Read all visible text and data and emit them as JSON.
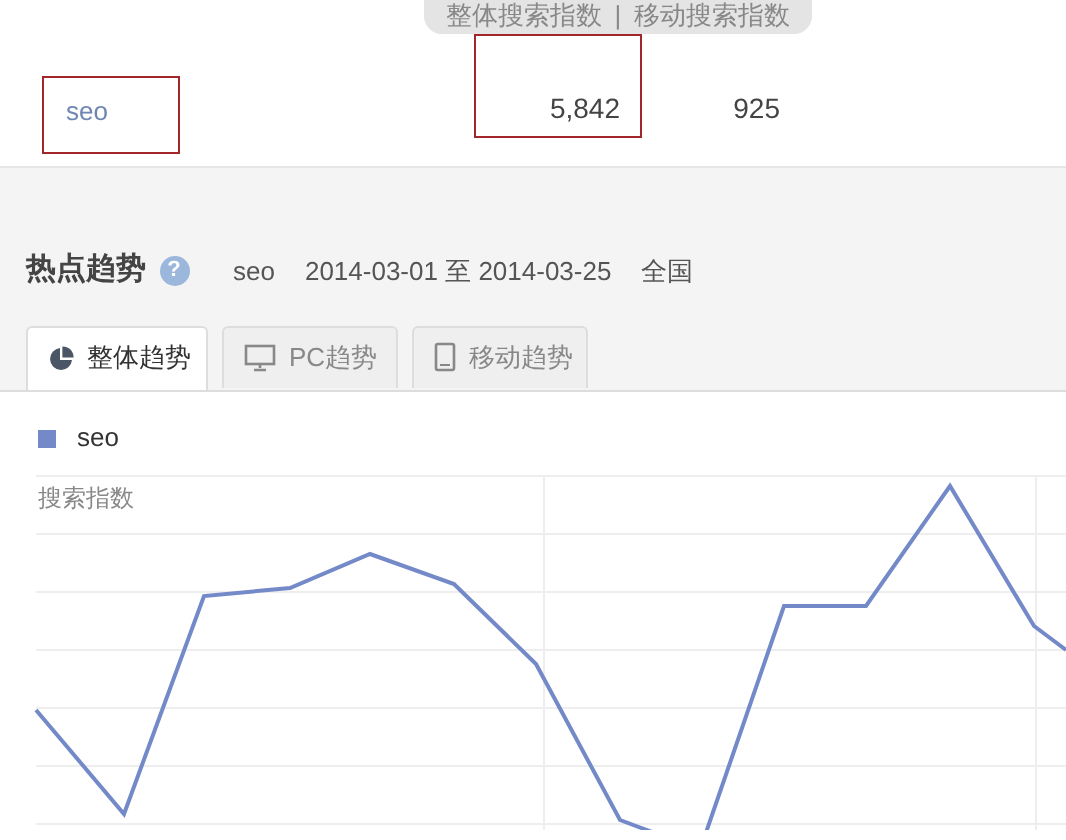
{
  "index_table": {
    "columns": [
      {
        "label": "整体搜索指数"
      },
      {
        "label": "移动搜索指数"
      }
    ],
    "separator": "|",
    "rows": [
      {
        "keyword": {
          "text": "seo",
          "highlighted": true
        },
        "cells": [
          {
            "text": "5,842",
            "highlighted": true
          },
          {
            "text": "925",
            "highlighted": false
          }
        ]
      }
    ]
  },
  "trend": {
    "title": "热点趋势",
    "help": "?",
    "keyword": "seo",
    "date_range": "2014-03-01 至 2014-03-25",
    "region": "全国",
    "tabs": [
      {
        "label": "整体趋势",
        "kind": "pie",
        "selected": true
      },
      {
        "label": "PC趋势",
        "kind": "monitor",
        "selected": false
      },
      {
        "label": "移动趋势",
        "kind": "tablet",
        "selected": false
      }
    ],
    "legend": [
      {
        "name": "seo",
        "color": "#7389c8"
      }
    ],
    "chart": {
      "ylabel": "搜索指数"
    }
  }
}
